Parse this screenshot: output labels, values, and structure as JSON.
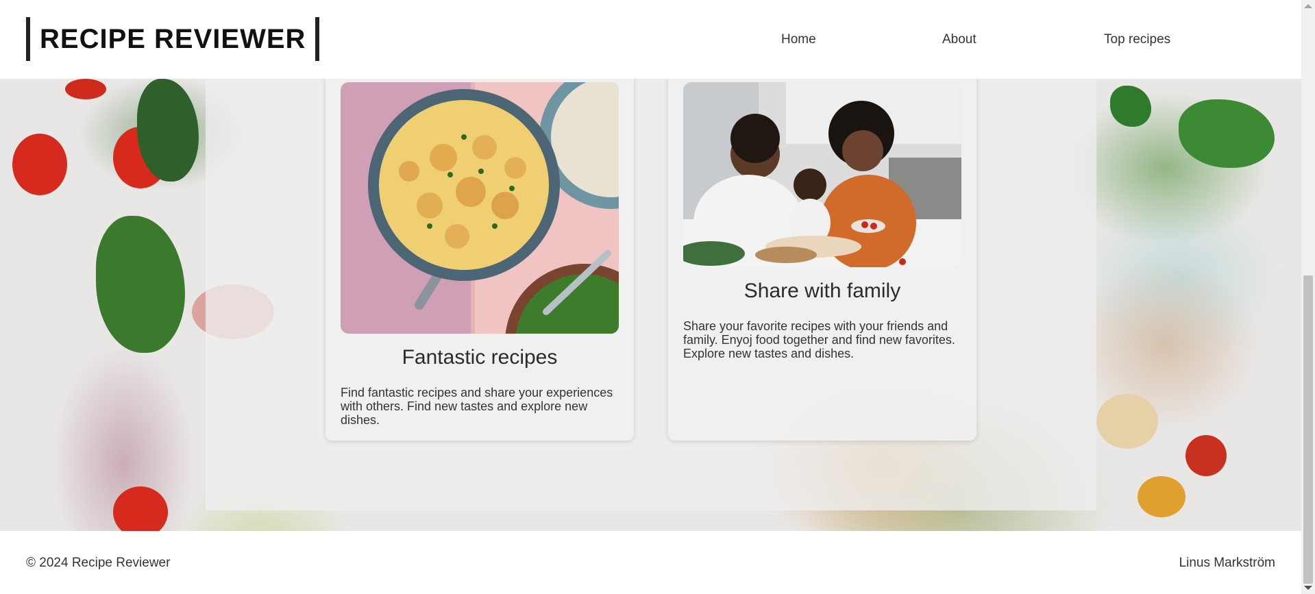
{
  "site": {
    "title": "RECIPE REVIEWER"
  },
  "nav": {
    "items": [
      "Home",
      "About",
      "Top recipes"
    ]
  },
  "cards": [
    {
      "title": "Fantastic recipes",
      "text": "Find fantastic recipes and share your experiences with others. Find new tastes and explore new dishes.",
      "image": "creamy-chicken-pan-photo"
    },
    {
      "title": "Share with family",
      "text": "Share your favorite recipes with your friends and family. Enyoj food together and find new favorites. Explore new tastes and dishes.",
      "image": "family-cooking-photo"
    }
  ],
  "footer": {
    "copyright": "© 2024 Recipe Reviewer",
    "author": "Linus Markström"
  }
}
